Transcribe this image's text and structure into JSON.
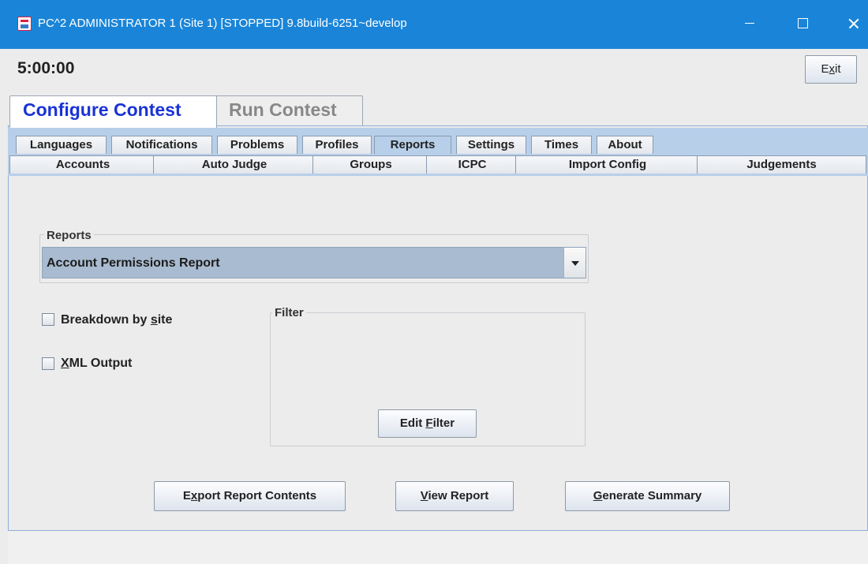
{
  "window": {
    "title": "PC^2 ADMINISTRATOR 1 (Site 1) [STOPPED] 9.8build-6251~develop",
    "app_icon": "java-icon",
    "controls": [
      "minimize-icon",
      "maximize-icon",
      "close-icon"
    ]
  },
  "header": {
    "clock": "5:00:00",
    "exit_label": "Exit",
    "exit_mnemonic": "x"
  },
  "outer_tabs": [
    {
      "label": "Configure Contest",
      "active": true
    },
    {
      "label": "Run Contest",
      "active": false
    }
  ],
  "inner_tabs": {
    "row1": [
      "Languages",
      "Notifications",
      "Problems",
      "Profiles",
      "Reports",
      "Settings",
      "Times",
      "About"
    ],
    "row2": [
      "Accounts",
      "Auto Judge",
      "Groups",
      "ICPC",
      "Import Config",
      "Judgements"
    ],
    "selected": "Reports"
  },
  "reports_panel": {
    "reports_group_title": "Reports",
    "selected_report": "Account Permissions Report",
    "breakdown_label": "Breakdown by site",
    "breakdown_checked": false,
    "xml_label": "XML Output",
    "xml_checked": false,
    "filter_group_title": "Filter",
    "edit_filter_label": "Edit Filter",
    "export_label": "Export Report Contents",
    "view_label": "View Report",
    "summary_label": "Generate Summary"
  },
  "colors": {
    "title_bar": "#1a85d8",
    "active_tab_text": "#1a33d6",
    "tab_strip": "#b8cfe9",
    "combo_selection": "#a9bbd0"
  }
}
